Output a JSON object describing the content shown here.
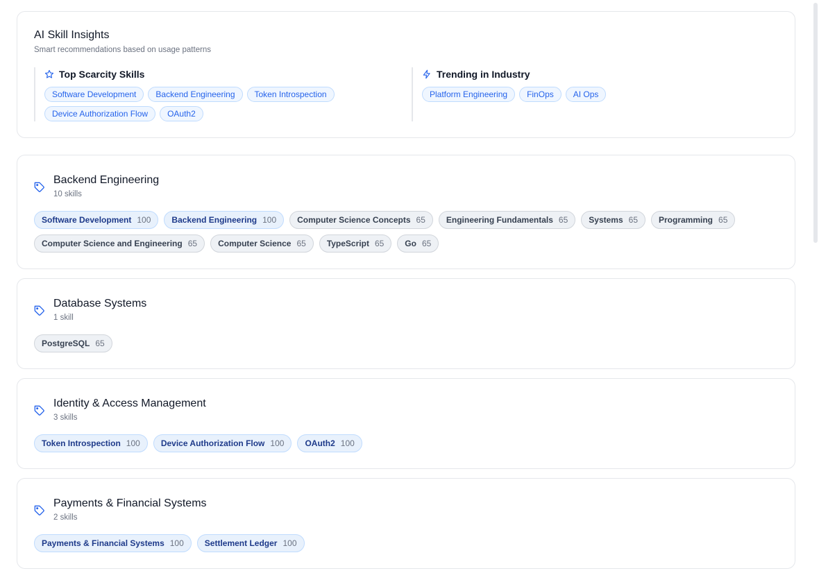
{
  "insights": {
    "title": "AI Skill Insights",
    "subtitle": "Smart recommendations based on usage patterns",
    "scarcity": {
      "title": "Top Scarcity Skills",
      "icon": "star-icon",
      "chips": [
        "Software Development",
        "Backend Engineering",
        "Token Introspection",
        "Device Authorization Flow",
        "OAuth2"
      ]
    },
    "trending": {
      "title": "Trending in Industry",
      "icon": "lightning-icon",
      "chips": [
        "Platform Engineering",
        "FinOps",
        "AI Ops"
      ]
    }
  },
  "categories": [
    {
      "title": "Backend Engineering",
      "count": "10 skills",
      "icon": "tag-icon",
      "skills": [
        {
          "name": "Software Development",
          "score": "100"
        },
        {
          "name": "Backend Engineering",
          "score": "100"
        },
        {
          "name": "Computer Science Concepts",
          "score": "65"
        },
        {
          "name": "Engineering Fundamentals",
          "score": "65"
        },
        {
          "name": "Systems",
          "score": "65"
        },
        {
          "name": "Programming",
          "score": "65"
        },
        {
          "name": "Computer Science and Engineering",
          "score": "65"
        },
        {
          "name": "Computer Science",
          "score": "65"
        },
        {
          "name": "TypeScript",
          "score": "65"
        },
        {
          "name": "Go",
          "score": "65"
        }
      ]
    },
    {
      "title": "Database Systems",
      "count": "1 skill",
      "icon": "tag-icon",
      "skills": [
        {
          "name": "PostgreSQL",
          "score": "65"
        }
      ]
    },
    {
      "title": "Identity & Access Management",
      "count": "3 skills",
      "icon": "tag-icon",
      "skills": [
        {
          "name": "Token Introspection",
          "score": "100"
        },
        {
          "name": "Device Authorization Flow",
          "score": "100"
        },
        {
          "name": "OAuth2",
          "score": "100"
        }
      ]
    },
    {
      "title": "Payments & Financial Systems",
      "count": "2 skills",
      "icon": "tag-icon",
      "skills": [
        {
          "name": "Payments & Financial Systems",
          "score": "100"
        },
        {
          "name": "Settlement Ledger",
          "score": "100"
        }
      ]
    }
  ],
  "colors": {
    "accent": "#2563eb",
    "chip_high_bg": "#e8f1fc",
    "chip_normal_bg": "#eef1f5"
  }
}
